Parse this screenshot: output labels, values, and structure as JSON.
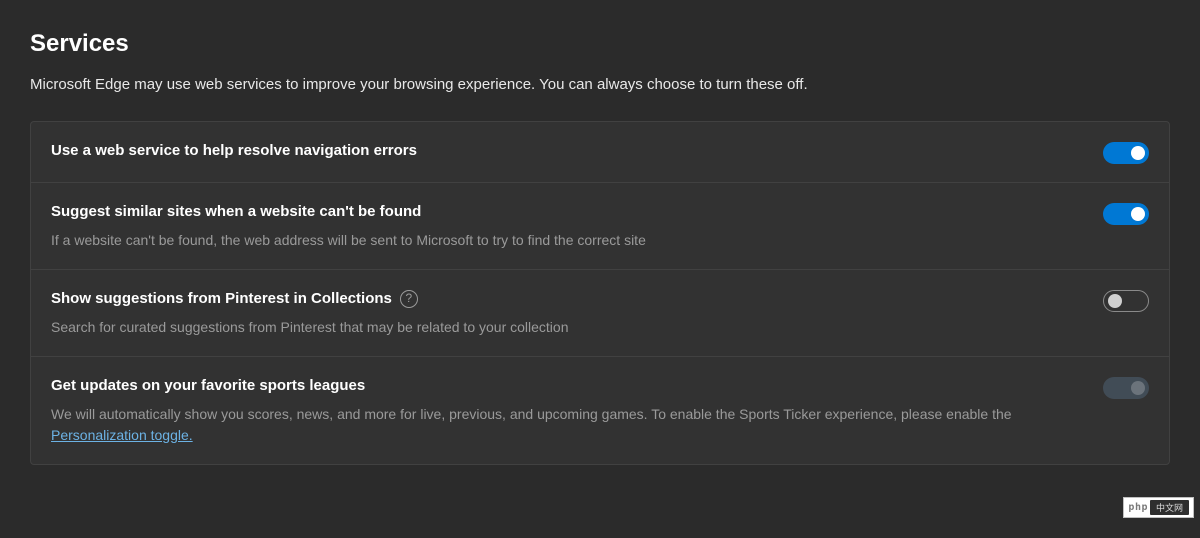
{
  "section": {
    "title": "Services",
    "description": "Microsoft Edge may use web services to improve your browsing experience. You can always choose to turn these off."
  },
  "settings": [
    {
      "title": "Use a web service to help resolve navigation errors",
      "subtitle": "",
      "state": "on",
      "help": false
    },
    {
      "title": "Suggest similar sites when a website can't be found",
      "subtitle": "If a website can't be found, the web address will be sent to Microsoft to try to find the correct site",
      "state": "on",
      "help": false
    },
    {
      "title": "Show suggestions from Pinterest in Collections",
      "subtitle": "Search for curated suggestions from Pinterest that may be related to your collection",
      "state": "off",
      "help": true
    },
    {
      "title": "Get updates on your favorite sports leagues",
      "subtitle_pre": "We will automatically show you scores, news, and more for live, previous, and upcoming games. To enable the Sports Ticker experience, please enable the ",
      "link_text": "Personalization toggle.",
      "state": "disabled",
      "help": false
    }
  ],
  "help_glyph": "?",
  "watermark": {
    "a": "php",
    "b": "中文网"
  }
}
